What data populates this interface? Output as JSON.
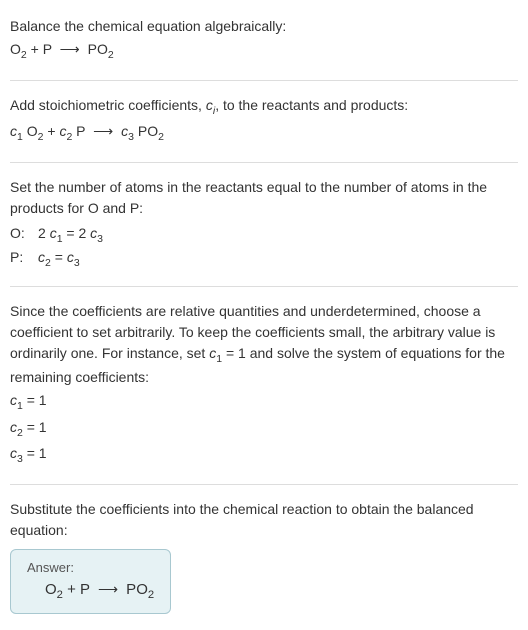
{
  "section1": {
    "intro": "Balance the chemical equation algebraically:",
    "equation_html": "O<sub>2</sub> + P <span class='arrow'>⟶</span> PO<sub>2</sub>"
  },
  "section2": {
    "intro_html": "Add stoichiometric coefficients, <span class='italic'>c<sub>i</sub></span>, to the reactants and products:",
    "equation_html": "<span class='italic'>c</span><sub>1</sub> O<sub>2</sub> + <span class='italic'>c</span><sub>2</sub> P <span class='arrow'>⟶</span> <span class='italic'>c</span><sub>3</sub> PO<sub>2</sub>"
  },
  "section3": {
    "intro": "Set the number of atoms in the reactants equal to the number of atoms in the products for O and P:",
    "rows": [
      {
        "element": "O:",
        "eq_html": "2 <span class='italic'>c</span><sub>1</sub> = 2 <span class='italic'>c</span><sub>3</sub>"
      },
      {
        "element": "P:",
        "eq_html": "<span class='italic'>c</span><sub>2</sub> = <span class='italic'>c</span><sub>3</sub>"
      }
    ]
  },
  "section4": {
    "intro_html": "Since the coefficients are relative quantities and underdetermined, choose a coefficient to set arbitrarily. To keep the coefficients small, the arbitrary value is ordinarily one. For instance, set <span class='italic'>c</span><sub>1</sub> = 1 and solve the system of equations for the remaining coefficients:",
    "assignments": [
      "<span class='italic'>c</span><sub>1</sub> = 1",
      "<span class='italic'>c</span><sub>2</sub> = 1",
      "<span class='italic'>c</span><sub>3</sub> = 1"
    ]
  },
  "section5": {
    "intro": "Substitute the coefficients into the chemical reaction to obtain the balanced equation:",
    "answer_label": "Answer:",
    "answer_equation_html": "O<sub>2</sub> + P <span class='arrow'>⟶</span> PO<sub>2</sub>"
  }
}
